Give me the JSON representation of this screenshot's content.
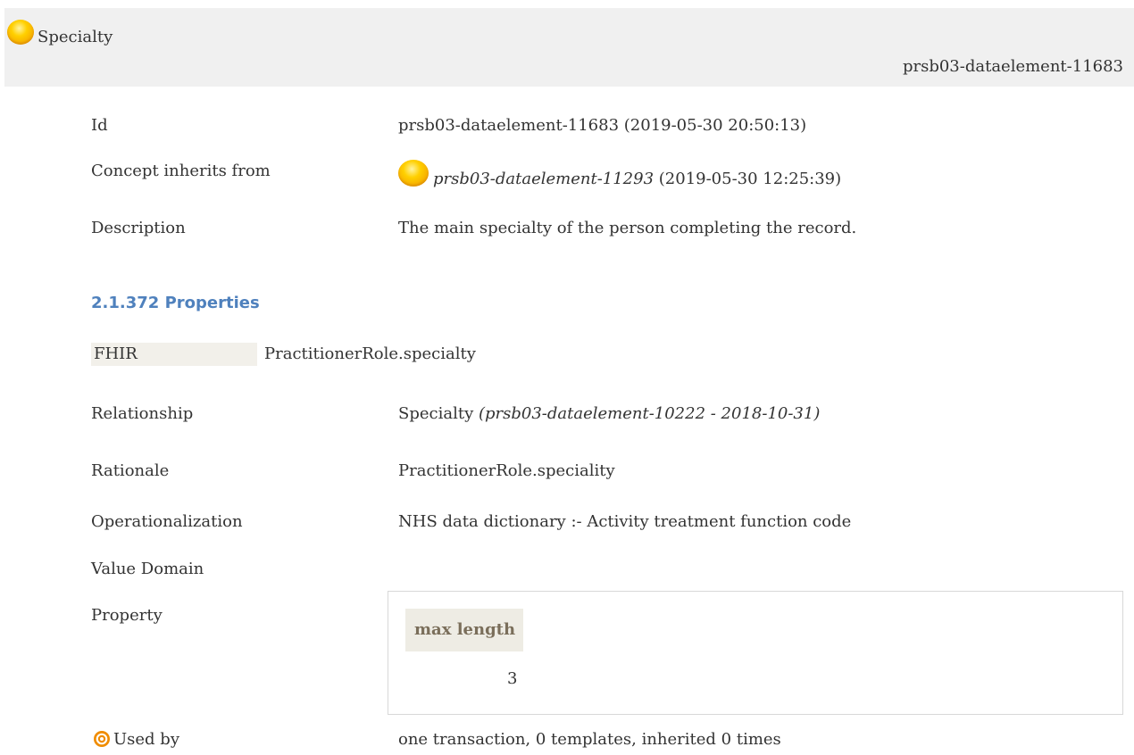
{
  "header": {
    "title": "Specialty",
    "id": "prsb03-dataelement-11683"
  },
  "details": {
    "id_label": "Id",
    "id_value": "prsb03-dataelement-11683 (2019-05-30 20:50:13)",
    "inherits_label": "Concept inherits from",
    "inherits_ref": "prsb03-dataelement-11293",
    "inherits_date": " (2019-05-30 12:25:39)",
    "description_label": "Description",
    "description_value": "The main specialty of the person completing the record."
  },
  "properties": {
    "heading": "2.1.372 Properties",
    "fhir_label": "FHIR",
    "fhir_value": "PractitionerRole.specialty",
    "relationship_label": "Relationship",
    "relationship_value": "Specialty ",
    "relationship_ref": "(prsb03-dataelement-10222 - 2018-10-31)",
    "rationale_label": "Rationale",
    "rationale_value": "PractitionerRole.speciality",
    "operationalization_label": "Operationalization",
    "operationalization_value": "NHS data dictionary :- Activity treatment function code",
    "value_domain_label": "Value Domain",
    "property_label": "Property",
    "property_header": "max length",
    "property_value": "3",
    "used_by_label": "Used by",
    "used_by_value": "one transaction, 0 templates, inherited 0 times"
  },
  "icons": {
    "concept_orb": "yellow-orb-icon",
    "used_by": "target-icon"
  },
  "colors": {
    "section_heading": "#4f81bd",
    "header_bg": "#f0f0f0",
    "orb": "#ffc000",
    "used_by_icon": "#f08c00"
  }
}
